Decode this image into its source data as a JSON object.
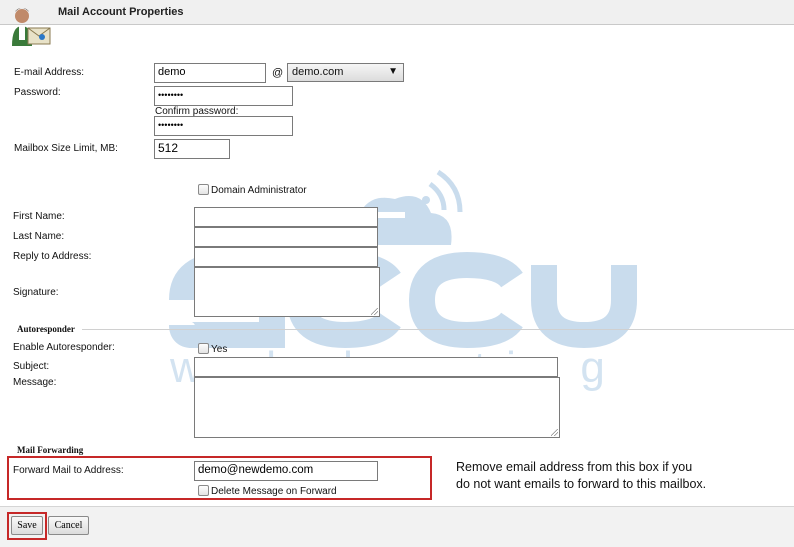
{
  "window": {
    "title": "Mail Account Properties"
  },
  "account": {
    "email_label": "E-mail Address:",
    "email_user": "demo",
    "at": "@",
    "domain": "demo.com",
    "password_label": "Password:",
    "password_value": "••••••••",
    "confirm_label": "Confirm password:",
    "confirm_value": "••••••••",
    "mailbox_label": "Mailbox Size Limit, MB:",
    "mailbox_value": "512",
    "domain_admin_label": "Domain Administrator",
    "first_name_label": "First Name:",
    "first_name_value": "",
    "last_name_label": "Last Name:",
    "last_name_value": "",
    "reply_label": "Reply to Address:",
    "reply_value": "",
    "signature_label": "Signature:"
  },
  "autoresponder": {
    "heading": "Autoresponder",
    "enable_label": "Enable Autoresponder:",
    "yes_label": "Yes",
    "subject_label": "Subject:",
    "subject_value": "",
    "message_label": "Message:"
  },
  "forwarding": {
    "heading": "Mail Forwarding",
    "forward_label": "Forward Mail to Address:",
    "forward_value": "demo@newdemo.com",
    "delete_label": "Delete Message on Forward"
  },
  "annotation": {
    "line1": "Remove email address from this box if you",
    "line2": "do not want emails to forward to this mailbox."
  },
  "buttons": {
    "save": "Save",
    "cancel": "Cancel"
  },
  "watermark": {
    "brand": "accu",
    "sub": "web hosting"
  },
  "colors": {
    "highlight": "#c62828",
    "watermark": "#c9dced"
  }
}
